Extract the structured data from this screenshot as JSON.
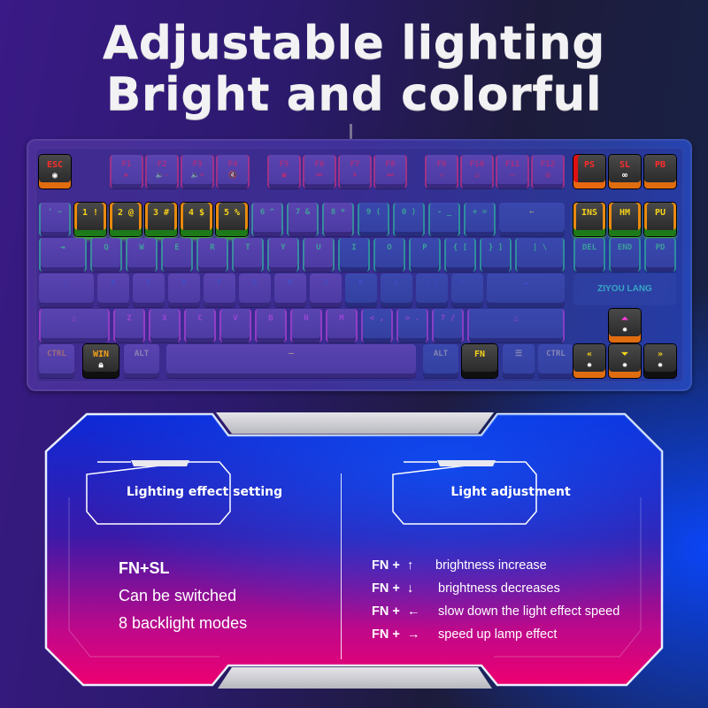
{
  "headline": {
    "line1": "Adjustable lighting",
    "line2": "Bright and colorful"
  },
  "keyboard": {
    "brand_logo": "ZIYOU LANG",
    "highlighted_keys": {
      "esc": {
        "label": "ESC",
        "icon": "lighting-mode-icon"
      },
      "num1": "1 !",
      "num2": "2 @",
      "num3": "3 #",
      "num4": "4 $",
      "num5": "5 %",
      "ps": "PS",
      "sl": {
        "label": "SL",
        "icon": "infinity-loop-icon"
      },
      "pb": "PB",
      "ins": "INS",
      "hm": "HM",
      "pu": "PU",
      "win": {
        "label": "WIN",
        "icon": "lock-icon"
      },
      "fn": "FN",
      "arrow_up": {
        "glyph": "⏶",
        "icon": "brightness-icon"
      },
      "arrow_left": {
        "glyph": "«",
        "icon": "brightness-icon"
      },
      "arrow_down": {
        "glyph": "⏷",
        "icon": "brightness-icon"
      },
      "arrow_right": {
        "glyph": "»",
        "icon": "brightness-icon"
      }
    },
    "function_keys": [
      {
        "label": "F1",
        "sub": "▶"
      },
      {
        "label": "F2",
        "sub": "🔈-"
      },
      {
        "label": "F3",
        "sub": "🔈+"
      },
      {
        "label": "F4",
        "sub": "🔇"
      },
      {
        "label": "F5",
        "sub": "■"
      },
      {
        "label": "F6",
        "sub": "⏮"
      },
      {
        "label": "F7",
        "sub": "⏵"
      },
      {
        "label": "F8",
        "sub": "⏭"
      },
      {
        "label": "F9",
        "sub": "✉"
      },
      {
        "label": "F10",
        "sub": "⌂"
      },
      {
        "label": "F11",
        "sub": "▭"
      },
      {
        "label": "F12",
        "sub": "▤"
      }
    ],
    "number_row_rest": [
      "' ~",
      "6 ^",
      "7 &",
      "8 *",
      "9 (",
      "0 )",
      "- _",
      "+ =",
      "←"
    ],
    "qwerty_row": [
      "⇥",
      "Q",
      "W",
      "E",
      "R",
      "T",
      "Y",
      "U",
      "I",
      "O",
      "P",
      "{ [",
      "} ]",
      "| \\"
    ],
    "nav_row": [
      "DEL",
      "END",
      "PD"
    ],
    "home_row": [
      "⇪",
      "A",
      "S",
      "D",
      "F",
      "G",
      "H",
      "J",
      "K",
      "L",
      ": ;",
      "\" '",
      "↵"
    ],
    "shift_row": [
      "△",
      "Z",
      "X",
      "C",
      "V",
      "B",
      "N",
      "M",
      "< ,",
      "> .",
      "? /",
      "△"
    ],
    "bottom_row": [
      "CTRL",
      "ALT",
      "—",
      "ALT",
      "☰",
      "CTRL"
    ]
  },
  "panel": {
    "left": {
      "title": "Lighting effect setting",
      "line1": "FN+SL",
      "line2": "Can be switched",
      "line3": "8 backlight modes"
    },
    "right": {
      "title": "Light adjustment",
      "rows": [
        {
          "combo": "FN +",
          "arrow": "↑",
          "text": "brightness increase"
        },
        {
          "combo": "FN +",
          "arrow": "↓",
          "text": "brightness decreases"
        },
        {
          "combo": "FN +",
          "arrow": "←",
          "text": "slow down the light effect speed"
        },
        {
          "combo": "FN +",
          "arrow": "→",
          "text": "speed up lamp effect"
        }
      ]
    }
  },
  "colors": {
    "highlight_yellow": "#f6d21a",
    "highlight_red": "#ff2b2b",
    "glow_orange": "#e06c10",
    "glow_green": "#50e030",
    "panel_pink": "#e8006e",
    "panel_blue": "#0a46ff"
  }
}
